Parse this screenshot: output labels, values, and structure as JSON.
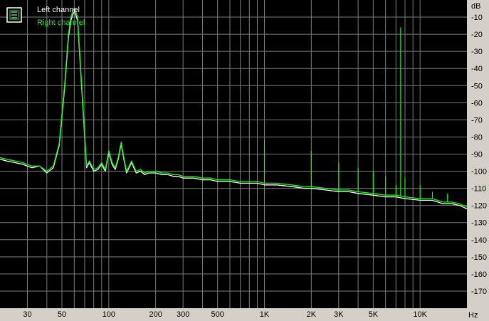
{
  "chart_data": {
    "type": "line",
    "x_scale": "log",
    "xlim": [
      20,
      20000
    ],
    "ylim": [
      -180,
      0
    ],
    "y_unit": "dB",
    "x_unit": "Hz",
    "grid": true,
    "legend_placement": "top-left",
    "x_ticks": [
      {
        "value": 30,
        "label": "30"
      },
      {
        "value": 50,
        "label": "50"
      },
      {
        "value": 100,
        "label": "100"
      },
      {
        "value": 200,
        "label": "200"
      },
      {
        "value": 300,
        "label": "300"
      },
      {
        "value": 500,
        "label": "500"
      },
      {
        "value": 1000,
        "label": "1K"
      },
      {
        "value": 2000,
        "label": "2K"
      },
      {
        "value": 3000,
        "label": "3K"
      },
      {
        "value": 5000,
        "label": "5K"
      },
      {
        "value": 10000,
        "label": "10K"
      }
    ],
    "y_ticks": [
      {
        "value": -10,
        "label": "-10"
      },
      {
        "value": -20,
        "label": "-20"
      },
      {
        "value": -30,
        "label": "-30"
      },
      {
        "value": -40,
        "label": "-40"
      },
      {
        "value": -50,
        "label": "-50"
      },
      {
        "value": -60,
        "label": "-60"
      },
      {
        "value": -70,
        "label": "-70"
      },
      {
        "value": -80,
        "label": "-80"
      },
      {
        "value": -90,
        "label": "-90"
      },
      {
        "value": -100,
        "label": "-100"
      },
      {
        "value": -110,
        "label": "-110"
      },
      {
        "value": -120,
        "label": "-120"
      },
      {
        "value": -130,
        "label": "-130"
      },
      {
        "value": -140,
        "label": "-140"
      },
      {
        "value": -150,
        "label": "-150"
      },
      {
        "value": -160,
        "label": "-160"
      },
      {
        "value": -170,
        "label": "-170"
      }
    ],
    "series": [
      {
        "name": "Left channel",
        "color": "#ffffff",
        "x": [
          20,
          22,
          25,
          28,
          32,
          36,
          40,
          44,
          48,
          52,
          55,
          57,
          59,
          60,
          61,
          63,
          66,
          70,
          72,
          75,
          80,
          85,
          90,
          95,
          100,
          105,
          110,
          115,
          120,
          125,
          130,
          140,
          150,
          160,
          170,
          180,
          200,
          220,
          240,
          260,
          280,
          300,
          350,
          400,
          450,
          500,
          600,
          700,
          800,
          900,
          1000,
          1200,
          1500,
          1800,
          2000,
          2500,
          3000,
          3500,
          4000,
          5000,
          6000,
          7000,
          8000,
          10000,
          12000,
          14000,
          16000,
          18000,
          20000
        ],
        "y": [
          -93,
          -94,
          -95,
          -96,
          -98,
          -97,
          -101,
          -98,
          -85,
          -52,
          -22,
          -12,
          -8,
          -7,
          -8,
          -12,
          -42,
          -80,
          -98,
          -95,
          -100,
          -99,
          -96,
          -100,
          -89,
          -96,
          -99,
          -93,
          -84,
          -93,
          -101,
          -95,
          -101,
          -100,
          -102,
          -101,
          -101,
          -102,
          -102,
          -103,
          -103,
          -104,
          -104,
          -105,
          -105,
          -106,
          -106,
          -107,
          -107,
          -107,
          -108,
          -108,
          -109,
          -110,
          -110,
          -111,
          -112,
          -112,
          -113,
          -114,
          -115,
          -115,
          -116,
          -117,
          -117,
          -119,
          -119,
          -120,
          -122
        ]
      },
      {
        "name": "Right channel",
        "color": "#00ff00",
        "x": [
          20,
          22,
          25,
          28,
          32,
          36,
          40,
          44,
          48,
          52,
          55,
          57,
          59,
          60,
          61,
          63,
          66,
          70,
          72,
          75,
          80,
          85,
          90,
          95,
          100,
          105,
          110,
          115,
          120,
          125,
          130,
          140,
          150,
          160,
          170,
          180,
          200,
          220,
          240,
          260,
          280,
          300,
          350,
          400,
          450,
          500,
          600,
          700,
          800,
          900,
          1000,
          1200,
          1500,
          1800,
          2000,
          2500,
          3000,
          3500,
          4000,
          5000,
          6000,
          7000,
          8000,
          10000,
          12000,
          14000,
          16000,
          18000,
          20000
        ],
        "y": [
          -92,
          -93,
          -94,
          -95,
          -97,
          -97,
          -100,
          -97,
          -84,
          -50,
          -20,
          -10,
          -6,
          -5,
          -6,
          -10,
          -40,
          -78,
          -97,
          -94,
          -99,
          -98,
          -95,
          -99,
          -88,
          -95,
          -98,
          -92,
          -83,
          -92,
          -100,
          -94,
          -100,
          -99,
          -101,
          -100,
          -100,
          -101,
          -101,
          -102,
          -102,
          -103,
          -103,
          -104,
          -104,
          -105,
          -105,
          -106,
          -106,
          -106,
          -107,
          -107,
          -108,
          -109,
          -109,
          -110,
          -111,
          -111,
          -112,
          -113,
          -114,
          -114,
          -115,
          -116,
          -116,
          -118,
          -118,
          -119,
          -121
        ]
      }
    ],
    "spikes": [
      {
        "x": 1000,
        "y": -82
      },
      {
        "x": 2000,
        "y": -88
      },
      {
        "x": 3000,
        "y": -95
      },
      {
        "x": 4000,
        "y": -98
      },
      {
        "x": 5000,
        "y": -100
      },
      {
        "x": 6000,
        "y": -103
      },
      {
        "x": 7000,
        "y": -108
      },
      {
        "x": 7500,
        "y": -16
      },
      {
        "x": 8000,
        "y": -104
      },
      {
        "x": 10000,
        "y": -108
      },
      {
        "x": 12000,
        "y": -112
      },
      {
        "x": 15000,
        "y": -113
      }
    ]
  }
}
